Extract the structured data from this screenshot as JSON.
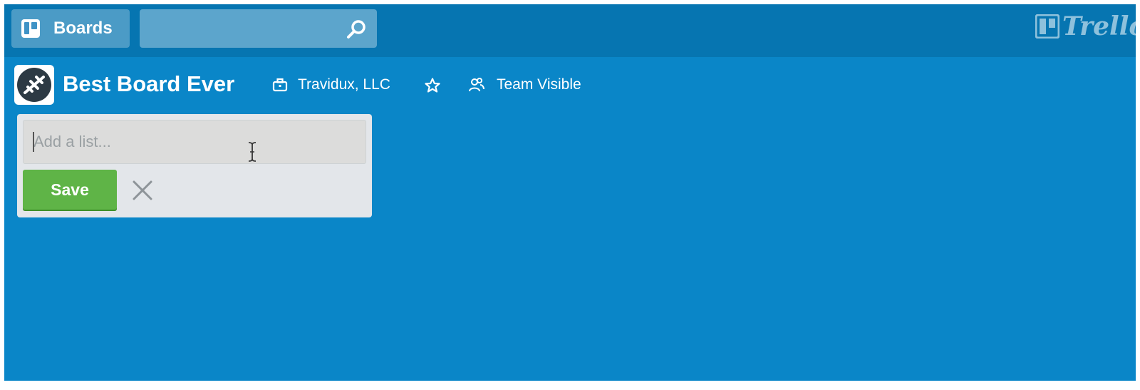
{
  "header": {
    "boards_label": "Boards",
    "search": {
      "value": "",
      "placeholder": ""
    },
    "logo_text": "Trello"
  },
  "board": {
    "title": "Best Board Ever",
    "organization": "Travidux, LLC",
    "visibility": "Team Visible"
  },
  "add_list": {
    "placeholder": "Add a list...",
    "value": "",
    "save_label": "Save"
  },
  "icons": {
    "boards": "boards-icon",
    "search": "search-icon",
    "logo": "trello-logo-icon",
    "avatar": "plane-icon",
    "organization": "briefcase-icon",
    "star": "star-icon",
    "visibility": "team-icon",
    "close": "close-icon"
  },
  "colors": {
    "board_background": "#0a86c8",
    "header_background": "#0675b1",
    "save_button": "#5fb447"
  }
}
